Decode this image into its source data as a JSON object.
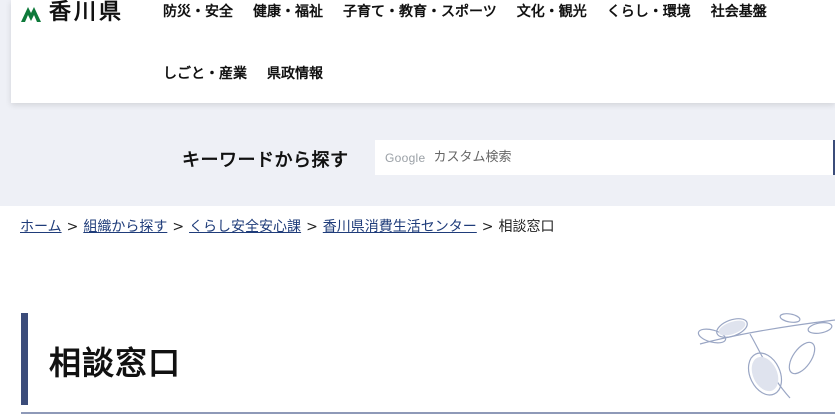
{
  "site": {
    "name": "香川県",
    "brand_color": "#0e7a3a",
    "accent_color": "#3b4c7a"
  },
  "nav": {
    "row1": [
      "防災・安全",
      "健康・福祉",
      "子育て・教育・スポーツ",
      "文化・観光",
      "くらし・環境",
      "社会基盤"
    ],
    "row2": [
      "しごと・産業",
      "県政情報"
    ]
  },
  "search": {
    "label": "キーワードから探す",
    "provider": "Google",
    "placeholder": "カスタム検索"
  },
  "breadcrumb": {
    "items": [
      "ホーム",
      "組織から探す",
      "くらし安全安心課",
      "香川県消費生活センター"
    ],
    "current": "相談窓口",
    "separator": ">"
  },
  "page": {
    "title": "相談窓口"
  }
}
